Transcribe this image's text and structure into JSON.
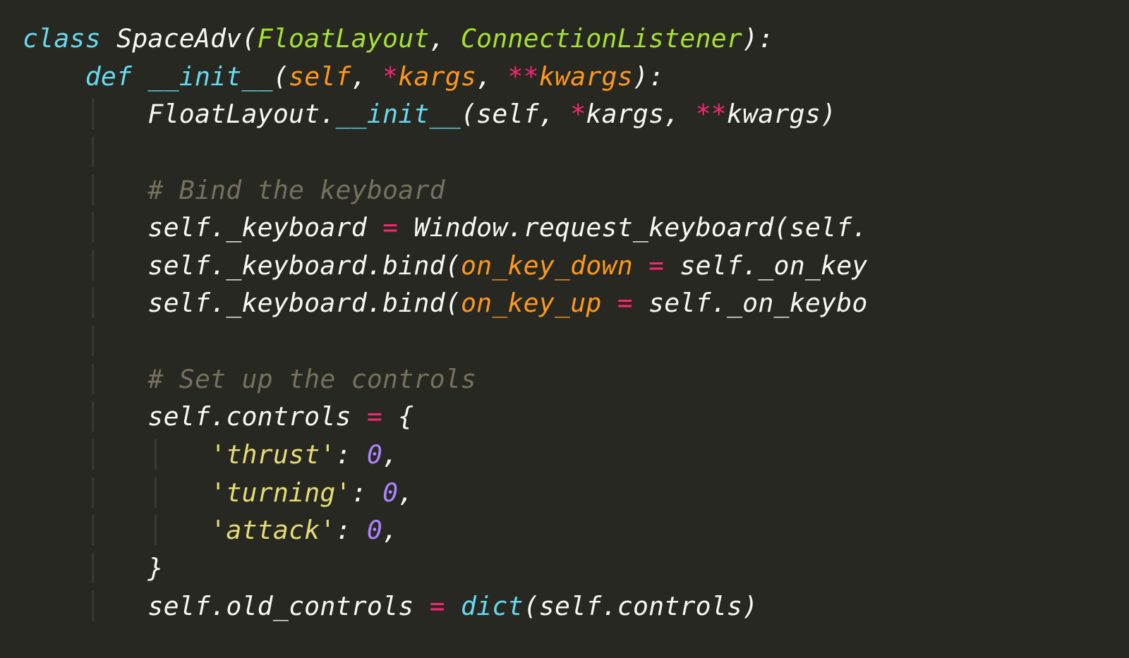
{
  "code": {
    "line1": {
      "kw_class": "class",
      "class_name": "SpaceAdv",
      "base1": "FloatLayout",
      "base2": "ConnectionListener"
    },
    "line2": {
      "kw_def": "def",
      "fn_name": "__init__",
      "arg_self": "self",
      "star": "*",
      "arg_kargs": "kargs",
      "dstar": "**",
      "arg_kwargs": "kwargs"
    },
    "line3": {
      "base_cls": "FloatLayout",
      "init_call": "__init__",
      "self": "self",
      "star": "*",
      "kargs": "kargs",
      "dstar": "**",
      "kwargs": "kwargs"
    },
    "comment1": "# Bind the keyboard",
    "line5": {
      "self": "self",
      "attr": "_keyboard",
      "win": "Window",
      "call": "request_keyboard",
      "arg_s": "self"
    },
    "line6": {
      "self": "self",
      "attr": "_keyboard",
      "bind": "bind",
      "kw": "on_key_down",
      "rhs_self": "self",
      "rhs_attr": "_on_key"
    },
    "line7": {
      "self": "self",
      "attr": "_keyboard",
      "bind": "bind",
      "kw": "on_key_up",
      "rhs_self": "self",
      "rhs_attr": "_on_keybo"
    },
    "comment2": "# Set up the controls",
    "line9": {
      "self": "self",
      "attr": "controls"
    },
    "entries": {
      "k1": "'thrust'",
      "v1": "0",
      "k2": "'turning'",
      "v2": "0",
      "k3": "'attack'",
      "v3": "0"
    },
    "line14": {
      "self1": "self",
      "attr1": "old_controls",
      "dict": "dict",
      "self2": "self",
      "attr2": "controls"
    }
  }
}
